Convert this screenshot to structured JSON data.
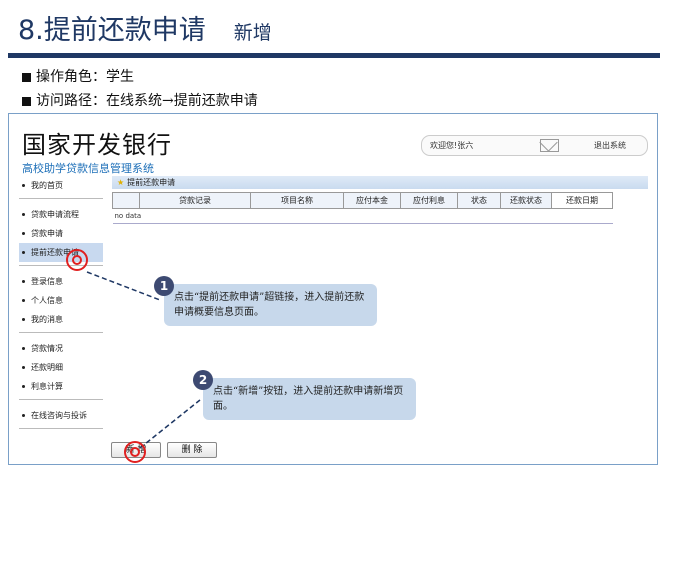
{
  "slide": {
    "title_number_text": "8.提前还款申请",
    "title_sub": "新增",
    "role_line": "操作角色：学生",
    "path_line": "访问路径：在线系统→提前还款申请"
  },
  "app": {
    "brand_name": "国家开发银行",
    "brand_sub": "高校助学贷款信息管理系统",
    "welcome": "欢迎您!张六",
    "logout": "退出系统",
    "breadcrumb": "提前还款申请"
  },
  "sidebar": {
    "groups": [
      [
        "我的首页"
      ],
      [
        "贷款申请流程",
        "贷款申请",
        "提前还款申请"
      ],
      [
        "登录信息",
        "个人信息",
        "我的消息"
      ],
      [
        "贷款情况",
        "还款明细",
        "利息计算"
      ],
      [
        "在线咨询与投诉"
      ]
    ],
    "active": "提前还款申请"
  },
  "table": {
    "headers": [
      "",
      "贷款记录",
      "项目名称",
      "应付本金",
      "应付利息",
      "状态",
      "还款状态",
      "还款日期"
    ],
    "empty_text": "no data"
  },
  "buttons": {
    "add": "新 增",
    "delete": "删 除"
  },
  "callouts": {
    "one_num": "1",
    "one_text": "点击“提前还款申请”超链接，进入提前还款申请概要信息页面。",
    "two_num": "2",
    "two_text": "点击“新增”按钮，进入提前还款申请新增页面。"
  },
  "colors": {
    "title": "#1f3864",
    "accent_blue": "#1d6fb8",
    "callout_bg": "#c7d8eb",
    "badge": "#3d4a72",
    "target_red": "#e02020"
  }
}
